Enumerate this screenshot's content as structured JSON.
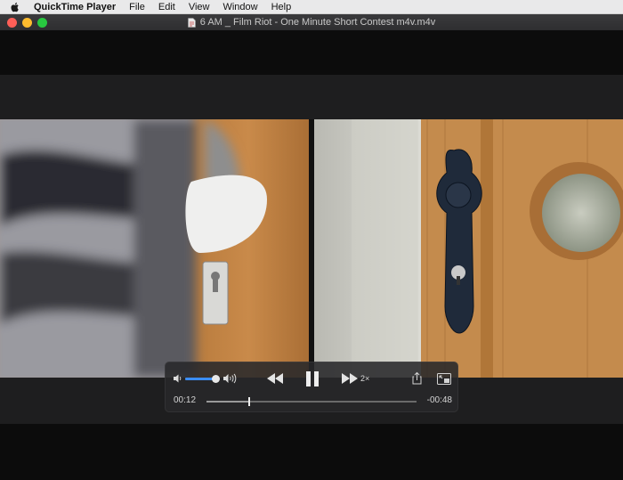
{
  "menubar": {
    "app_name": "QuickTime Player",
    "items": [
      "File",
      "Edit",
      "View",
      "Window",
      "Help"
    ]
  },
  "window": {
    "title": "6 AM _ Film Riot - One Minute Short Contest m4v.m4v"
  },
  "controls": {
    "elapsed": "00:12",
    "remaining": "-00:48",
    "speed_label": "2×",
    "progress_fraction": 0.2,
    "volume_fraction": 1.0,
    "icons": [
      "volume-low-icon",
      "volume-high-icon",
      "rewind-icon",
      "pause-icon",
      "fast-forward-icon",
      "share-icon",
      "picture-in-picture-icon"
    ]
  },
  "colors": {
    "accent": "#3b8df5",
    "close": "#ff5f57",
    "minimize": "#febc2e",
    "maximize": "#28c840"
  }
}
